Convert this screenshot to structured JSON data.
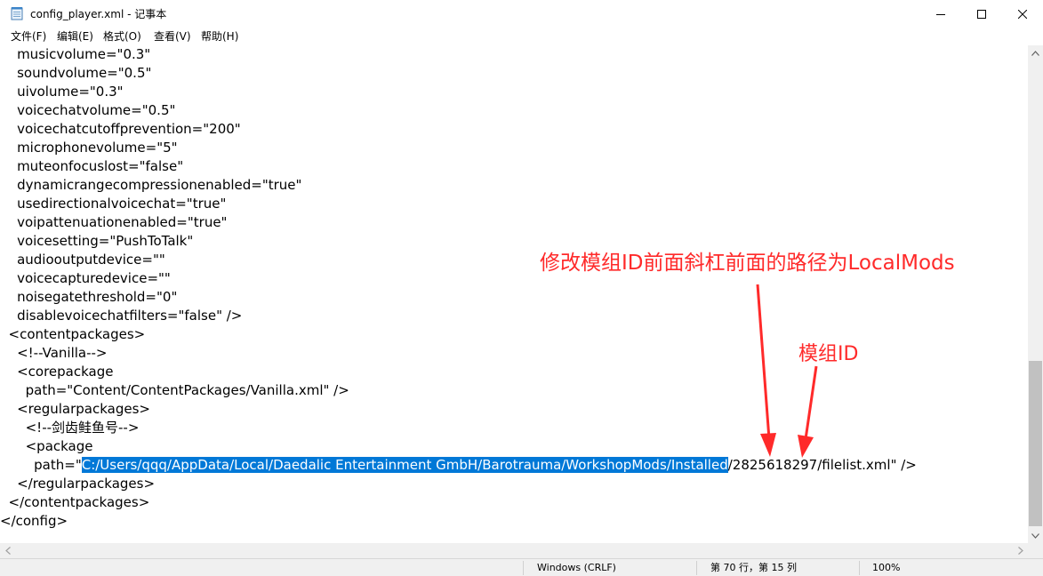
{
  "window": {
    "title": "config_player.xml - 记事本"
  },
  "menu": {
    "items": [
      "文件(F)",
      "编辑(E)",
      "格式(O)",
      "查看(V)",
      "帮助(H)"
    ]
  },
  "editor": {
    "lines": [
      "    musicvolume=\"0.3\"",
      "    soundvolume=\"0.5\"",
      "    uivolume=\"0.3\"",
      "    voicechatvolume=\"0.5\"",
      "    voicechatcutoffprevention=\"200\"",
      "    microphonevolume=\"5\"",
      "    muteonfocuslost=\"false\"",
      "    dynamicrangecompressionenabled=\"true\"",
      "    usedirectionalvoicechat=\"true\"",
      "    voipattenuationenabled=\"true\"",
      "    voicesetting=\"PushToTalk\"",
      "    audiooutputdevice=\"\"",
      "    voicecapturedevice=\"\"",
      "    noisegatethreshold=\"0\"",
      "    disablevoicechatfilters=\"false\" />",
      "  <contentpackages>",
      "    <!--Vanilla-->",
      "    <corepackage",
      "      path=\"Content/ContentPackages/Vanilla.xml\" />",
      "    <regularpackages>",
      "      <!--剑齿鲑鱼号-->",
      "      <package"
    ],
    "path_line": {
      "prefix": "        path=\"",
      "selected": "C:/Users/qqq/AppData/Local/Daedalic Entertainment GmbH/Barotrauma/WorkshopMods/Installed",
      "suffix": "/2825618297/filelist.xml\" />"
    },
    "lines_after": [
      "    </regularpackages>",
      "  </contentpackages>",
      "</config>"
    ]
  },
  "statusbar": {
    "line_ending": "Windows (CRLF)",
    "position": "第 70 行，第 15 列",
    "zoom": "100%"
  },
  "annotations": {
    "main": "修改模组ID前面斜杠前面的路径为LocalMods",
    "mod_id": "模组ID",
    "color": "#ff2a2a"
  },
  "colors": {
    "selection": "#0078d7"
  }
}
